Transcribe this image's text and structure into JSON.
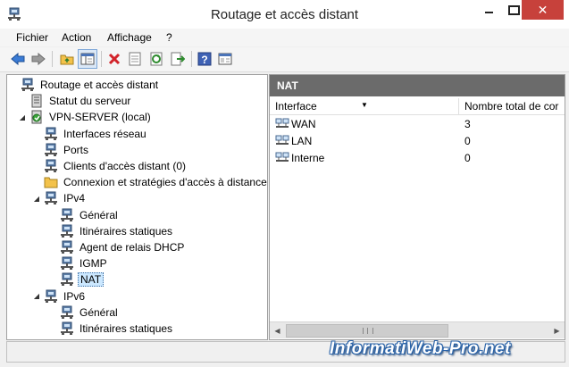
{
  "window": {
    "title": "Routage et accès distant"
  },
  "menu": {
    "items": [
      "Fichier",
      "Action",
      "Affichage",
      "?"
    ]
  },
  "toolbar": {
    "buttons": [
      "back-arrow-icon",
      "forward-arrow-icon",
      "up-folder-icon",
      "show-hide-tree-icon",
      "delete-icon",
      "properties-icon",
      "refresh-icon",
      "export-list-icon",
      "help-icon",
      "console-icon"
    ]
  },
  "tree": {
    "items": [
      {
        "label": "Routage et accès distant",
        "level": 0,
        "expander": "",
        "icon": "server-tree-icon"
      },
      {
        "label": "Statut du serveur",
        "level": 1,
        "expander": "",
        "icon": "server-status-icon"
      },
      {
        "label": "VPN-SERVER (local)",
        "level": 1,
        "expander": "◢",
        "icon": "vpn-server-icon"
      },
      {
        "label": "Interfaces réseau",
        "level": 2,
        "expander": "",
        "icon": "network-interfaces-icon"
      },
      {
        "label": "Ports",
        "level": 2,
        "expander": "",
        "icon": "ports-icon"
      },
      {
        "label": "Clients d'accès distant (0)",
        "level": 2,
        "expander": "",
        "icon": "remote-clients-icon"
      },
      {
        "label": "Connexion et stratégies d'accès à distance",
        "level": 2,
        "expander": "",
        "icon": "policies-folder-icon"
      },
      {
        "label": "IPv4",
        "level": 2,
        "expander": "◢",
        "icon": "ipv4-icon"
      },
      {
        "label": "Général",
        "level": 3,
        "expander": "",
        "icon": "general-icon"
      },
      {
        "label": "Itinéraires statiques",
        "level": 3,
        "expander": "",
        "icon": "static-routes-icon"
      },
      {
        "label": "Agent de relais DHCP",
        "level": 3,
        "expander": "",
        "icon": "dhcp-relay-icon"
      },
      {
        "label": "IGMP",
        "level": 3,
        "expander": "",
        "icon": "igmp-icon"
      },
      {
        "label": "NAT",
        "level": 3,
        "expander": "",
        "icon": "nat-icon",
        "selected": true
      },
      {
        "label": "IPv6",
        "level": 2,
        "expander": "◢",
        "icon": "ipv6-icon"
      },
      {
        "label": "Général",
        "level": 3,
        "expander": "",
        "icon": "general-icon"
      },
      {
        "label": "Itinéraires statiques",
        "level": 3,
        "expander": "",
        "icon": "static-routes-icon"
      }
    ]
  },
  "details": {
    "header": "NAT",
    "columns": [
      "Interface",
      "Nombre total de cor"
    ],
    "sort_indicator": "▼",
    "rows": [
      {
        "interface": "WAN",
        "count": "3"
      },
      {
        "interface": "LAN",
        "count": "0"
      },
      {
        "interface": "Interne",
        "count": "0"
      }
    ]
  },
  "scrollbar": {
    "left_arrow": "◀",
    "right_arrow": "▶"
  },
  "watermark": "InformatiWeb-Pro.net",
  "colors": {
    "pane_header": "#6b6b6b",
    "selection": "#cce8ff",
    "close_button": "#c7413b"
  }
}
